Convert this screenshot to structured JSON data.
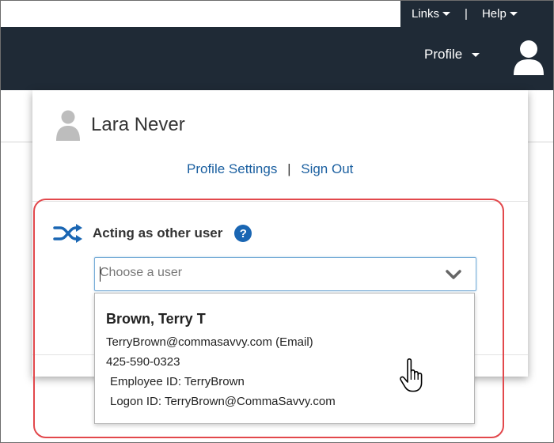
{
  "top_nav": {
    "links_label": "Links",
    "separator": "|",
    "help_label": "Help"
  },
  "header": {
    "profile_label": "Profile"
  },
  "profile_popover": {
    "user_name": "Lara Never",
    "profile_settings_label": "Profile Settings",
    "link_separator": "|",
    "sign_out_label": "Sign Out",
    "acting_title": "Acting as other user",
    "help_glyph": "?",
    "user_select": {
      "placeholder": "Choose a user",
      "value": ""
    },
    "results": [
      {
        "name": "Brown, Terry T",
        "email": "TerryBrown@commasavvy.com (Email)",
        "phone": "425-590-0323",
        "employee_id": "Employee ID: TerryBrown",
        "logon_id": "Logon ID: TerryBrown@CommaSavvy.com"
      }
    ]
  },
  "colors": {
    "header_bg": "#1f2a36",
    "link_blue": "#1a5fa0",
    "help_blue": "#1a66b3",
    "highlight_red": "#e2484c"
  },
  "icons": {
    "avatar": "user-silhouette-icon",
    "acting": "shuffle-icon",
    "help": "question-circle-icon",
    "dropdown": "chevron-down-icon",
    "pointer": "hand-cursor-icon"
  }
}
